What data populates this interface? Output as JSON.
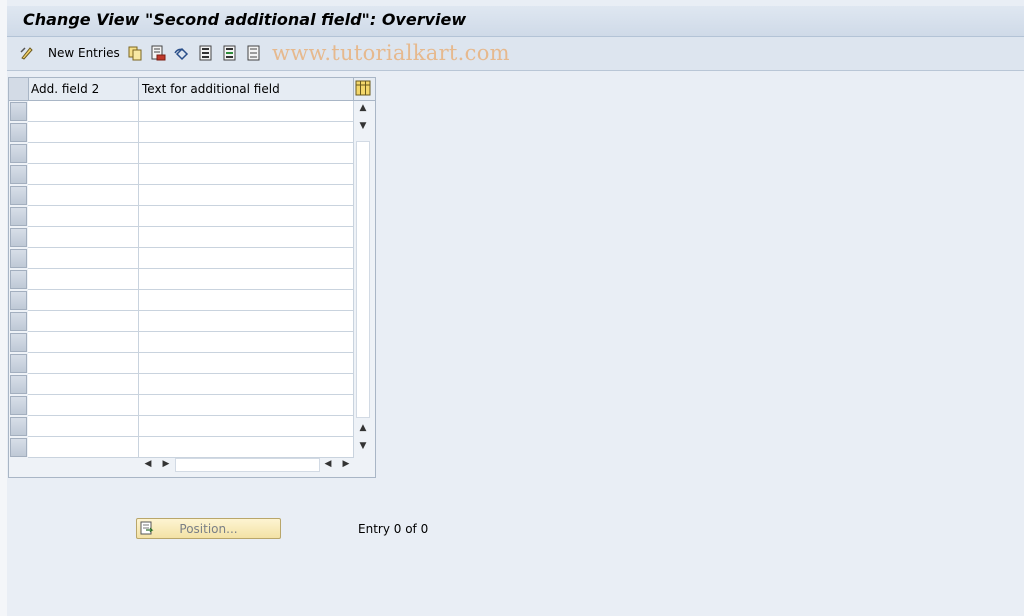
{
  "title": "Change View \"Second additional field\": Overview",
  "toolbar": {
    "new_entries_label": "New Entries",
    "icons": [
      "display-change-icon",
      "copy-icon",
      "delete-icon",
      "undo-icon",
      "select-all-icon",
      "select-block-icon",
      "deselect-all-icon"
    ]
  },
  "watermark": "www.tutorialkart.com",
  "table": {
    "columns": [
      "Add. field 2",
      "Text for additional field"
    ],
    "row_count": 17,
    "rows": []
  },
  "position_button": {
    "label": "Position..."
  },
  "entry_status": "Entry 0 of 0",
  "colors": {
    "background": "#e9eef5",
    "header": "#dfe7f1",
    "button": "#f7e9b5"
  }
}
